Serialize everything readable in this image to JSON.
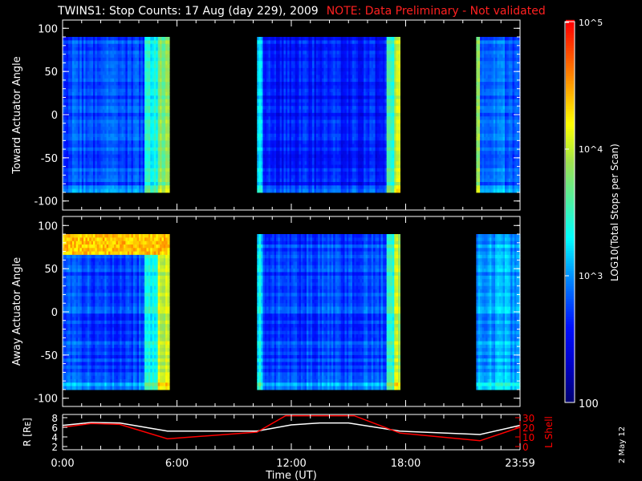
{
  "title": "TWINS1: Stop Counts: 17 Aug (day 229), 2009",
  "note": "NOTE: Data Preliminary - Not validated",
  "date_stamp": "2 May 12",
  "chart_data": [
    {
      "type": "heatmap",
      "panel": "toward",
      "ylabel": "Toward Actuator Angle",
      "ylim": [
        -110,
        110
      ],
      "yticks": [
        "100",
        "50",
        "0",
        "-50",
        "-100"
      ],
      "ytick_values": [
        100,
        50,
        0,
        -50,
        -100
      ],
      "data_angle_range": [
        -90,
        90
      ],
      "blocks": [
        {
          "t0": 0.0,
          "t1": 5.57,
          "base_log": 2.75,
          "edges": [
            {
              "t0": 4.3,
              "t1": 5.0,
              "log": 3.35
            },
            {
              "t0": 5.0,
              "t1": 5.57,
              "log": 3.8
            }
          ]
        },
        {
          "t0": 10.2,
          "t1": 17.65,
          "base_log": 2.6,
          "edges": [
            {
              "t0": 10.2,
              "t1": 10.4,
              "log": 3.3
            },
            {
              "t0": 17.0,
              "t1": 17.4,
              "log": 3.5
            },
            {
              "t0": 17.4,
              "t1": 17.65,
              "log": 4.0
            }
          ]
        },
        {
          "t0": 21.7,
          "t1": 24.0,
          "base_log": 2.85,
          "edges": [
            {
              "t0": 21.7,
              "t1": 21.85,
              "log": 3.9
            }
          ]
        }
      ],
      "bands": []
    },
    {
      "type": "heatmap",
      "panel": "away",
      "ylabel": "Away Actuator Angle",
      "ylim": [
        -110,
        110
      ],
      "yticks": [
        "100",
        "50",
        "0",
        "-50",
        "-100"
      ],
      "ytick_values": [
        100,
        50,
        0,
        -50,
        -100
      ],
      "data_angle_range": [
        -90,
        90
      ],
      "blocks": [
        {
          "t0": 0.0,
          "t1": 5.57,
          "base_log": 2.75,
          "edges": [
            {
              "t0": 4.3,
              "t1": 5.0,
              "log": 3.3
            },
            {
              "t0": 5.0,
              "t1": 5.57,
              "log": 4.0
            }
          ]
        },
        {
          "t0": 10.2,
          "t1": 17.65,
          "base_log": 2.75,
          "edges": [
            {
              "t0": 10.2,
              "t1": 10.4,
              "log": 3.3
            },
            {
              "t0": 17.0,
              "t1": 17.4,
              "log": 3.5
            },
            {
              "t0": 17.4,
              "t1": 17.65,
              "log": 4.0
            }
          ]
        },
        {
          "t0": 21.7,
          "t1": 24.0,
          "base_log": 3.05,
          "edges": []
        }
      ],
      "bands": [
        {
          "t0": 0.0,
          "t1": 5.5,
          "deg0": 68,
          "deg1": 90,
          "log": 4.3
        }
      ]
    },
    {
      "type": "line",
      "panel": "orbit",
      "xlabel": "Time (UT)",
      "xticks": [
        "0:00",
        "6:00",
        "12:00",
        "18:00",
        "23:59"
      ],
      "xtick_values": [
        0,
        6,
        12,
        18,
        24
      ],
      "xlim": [
        0,
        24
      ],
      "left_axis": {
        "label": "R [Rᴇ]",
        "ylim": [
          2,
          8
        ],
        "yticks": [
          "2",
          "4",
          "6",
          "8"
        ],
        "ytick_values": [
          2,
          4,
          6,
          8
        ]
      },
      "right_axis": {
        "label": "L Shell",
        "ylim": [
          0,
          30
        ],
        "yticks": [
          "0",
          "10",
          "20",
          "30"
        ],
        "ytick_values": [
          0,
          10,
          20,
          30
        ],
        "color": "#ff0000"
      },
      "series": [
        {
          "name": "R",
          "axis": "left",
          "color": "#ffffff",
          "x": [
            0,
            1.5,
            3,
            5.5,
            10.2,
            12,
            13.5,
            15,
            17.7,
            21.9,
            24
          ],
          "y": [
            6.4,
            7.0,
            6.9,
            5.2,
            5.2,
            6.5,
            6.9,
            6.9,
            5.2,
            4.5,
            6.4
          ]
        },
        {
          "name": "L Shell",
          "axis": "right",
          "color": "#ff0000",
          "x": [
            0,
            1.5,
            3,
            5.5,
            10.2,
            11.7,
            15.3,
            17.7,
            21.9,
            24
          ],
          "y": [
            20,
            24,
            23,
            8,
            15,
            32,
            32,
            14,
            6,
            20
          ]
        }
      ]
    },
    {
      "type": "colorbar",
      "label": "LOG10(Total Stops per Scan)",
      "range_log": [
        2,
        5
      ],
      "ticks": [
        "100",
        "10^3",
        "10^4",
        "10^5"
      ],
      "tick_values_log": [
        2,
        3,
        4,
        5
      ]
    }
  ]
}
